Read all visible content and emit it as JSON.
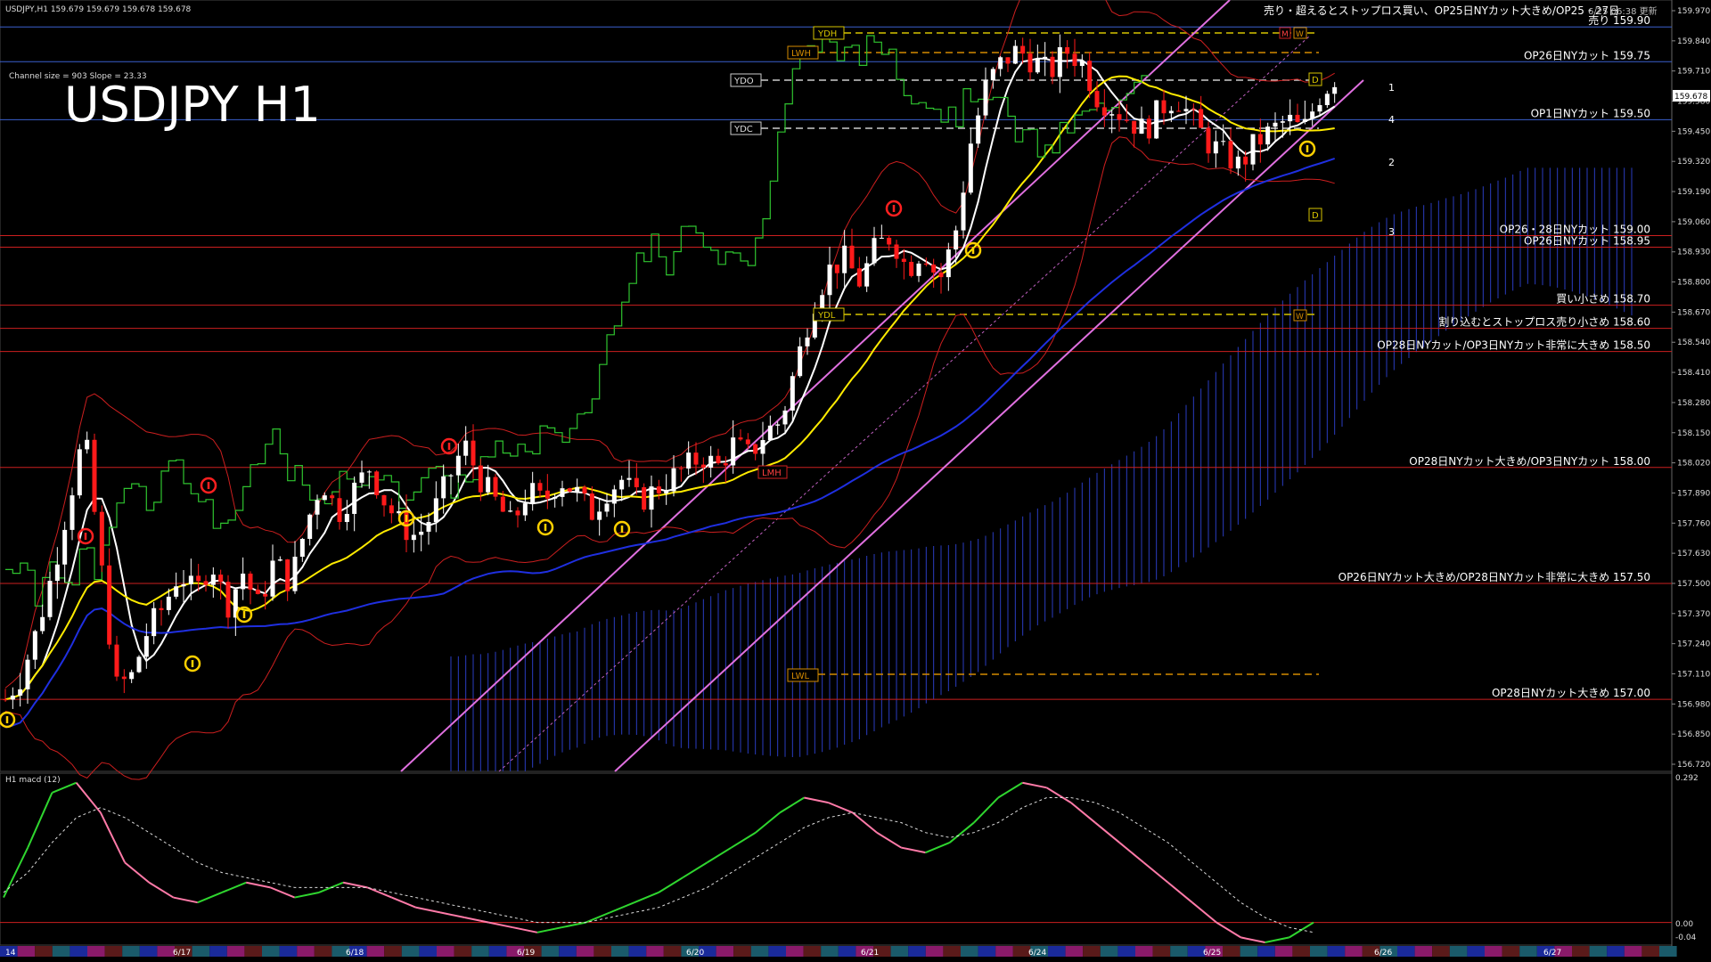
{
  "header": {
    "symbol_info": "USDJPY,H1  159.679 159.679 159.678 159.678",
    "big_title": "USDJPY H1",
    "channel_info": "Channel size = 903 Slope = 23.33",
    "top_right_note": "売り・超えるとストップロス買い、OP25日NYカット大きめ/OP25・27日",
    "update_stamp": "6/25 06:38 更新"
  },
  "price_axis": {
    "ticks": [
      "159.970",
      "159.840",
      "159.710",
      "159.580",
      "159.450",
      "159.320",
      "159.190",
      "159.060",
      "158.930",
      "158.800",
      "158.670",
      "158.540",
      "158.410",
      "158.280",
      "158.150",
      "158.020",
      "157.890",
      "157.760",
      "157.630",
      "157.500",
      "157.370",
      "157.240",
      "157.110",
      "156.980",
      "156.850",
      "156.720"
    ],
    "current_price": "159.678"
  },
  "levels": [
    {
      "label": "売り 159.90",
      "price": 159.9,
      "color": "#3a5fcd"
    },
    {
      "label": "OP26日NYカット 159.75",
      "price": 159.75,
      "color": "#3a5fcd"
    },
    {
      "label": "OP1日NYカット 159.50",
      "price": 159.5,
      "color": "#3a5fcd"
    },
    {
      "label": "OP26・28日NYカット 159.00",
      "price": 159.0,
      "color": "#cc1f1f"
    },
    {
      "label": "OP26日NYカット 158.95",
      "price": 158.95,
      "color": "#cc1f1f"
    },
    {
      "label": "買い小さめ 158.70",
      "price": 158.7,
      "color": "#cc1f1f"
    },
    {
      "label": "割り込むとストップロス売り小さめ 158.60",
      "price": 158.6,
      "color": "#cc1f1f"
    },
    {
      "label": "OP28日NYカット/OP3日NYカット非常に大きめ 158.50",
      "price": 158.5,
      "color": "#cc1f1f"
    },
    {
      "label": "OP28日NYカット大きめ/OP3日NYカット 158.00",
      "price": 158.0,
      "color": "#cc1f1f"
    },
    {
      "label": "OP26日NYカット大きめ/OP28日NYカット非常に大きめ 157.50",
      "price": 157.5,
      "color": "#cc1f1f"
    },
    {
      "label": "OP28日NYカット大きめ 157.00",
      "price": 157.0,
      "color": "#cc1f1f"
    }
  ],
  "markers": {
    "ydh": "YDH",
    "lwh": "LWH",
    "ydo": "YDO",
    "ydc": "YDC",
    "ydl": "YDL",
    "lwl": "LWL",
    "lmh": "LMH",
    "d_top": "D",
    "d_bottom": "D",
    "w_top": "W",
    "m_top": "M",
    "w_bottom": "W",
    "proj_1": "1",
    "proj_2": "2",
    "proj_3": "3",
    "proj_4": "4"
  },
  "macd_panel": {
    "label": "H1  macd (12)",
    "ticks": [
      "0.292",
      "0.00",
      "-0.04"
    ]
  },
  "time_axis": {
    "labels": [
      "14",
      "6/17",
      "6/18",
      "6/19",
      "6/20",
      "6/21",
      "6/24",
      "6/25",
      "6/26",
      "6/27"
    ]
  },
  "chart_data": {
    "type": "candlestick",
    "symbol": "USDJPY",
    "timeframe": "H1",
    "ylim": [
      156.72,
      159.97
    ],
    "close_path": [
      157.0,
      157.1,
      157.3,
      157.55,
      157.85,
      158.15,
      157.6,
      157.05,
      157.1,
      157.3,
      157.4,
      157.55,
      157.45,
      157.6,
      157.4,
      157.55,
      157.4,
      157.6,
      157.5,
      157.75,
      157.95,
      157.8,
      157.9,
      158.0,
      157.85,
      157.75,
      157.7,
      157.8,
      157.95,
      158.1,
      157.95,
      157.85,
      157.75,
      157.9,
      157.85,
      157.95,
      157.9,
      157.8,
      157.9,
      157.95,
      157.85,
      157.9,
      157.95,
      158.0,
      158.05,
      158.0,
      158.1,
      158.05,
      158.15,
      158.2,
      158.45,
      158.7,
      158.85,
      158.9,
      158.8,
      158.95,
      159.0,
      158.85,
      158.95,
      158.8,
      159.0,
      159.4,
      159.65,
      159.75,
      159.8,
      159.75,
      159.7,
      159.8,
      159.75,
      159.6,
      159.55,
      159.5,
      159.45,
      159.55,
      159.6,
      159.5,
      159.4,
      159.35,
      159.3,
      159.4,
      159.45,
      159.5,
      159.45,
      159.6,
      159.68
    ],
    "series": [
      {
        "name": "",
        "color": "#ffffff",
        "kind": "ma-fast"
      },
      {
        "name": "",
        "color": "#ffeb00",
        "kind": "ma-mid"
      },
      {
        "name": "",
        "color": "#1f2fe0",
        "kind": "ma-slow"
      },
      {
        "name": "",
        "color": "#2fc42f",
        "kind": "chikou"
      }
    ],
    "macd": {
      "line": [
        0.05,
        0.15,
        0.26,
        0.28,
        0.22,
        0.12,
        0.08,
        0.05,
        0.04,
        0.06,
        0.08,
        0.07,
        0.05,
        0.06,
        0.08,
        0.07,
        0.05,
        0.03,
        0.02,
        0.01,
        0.0,
        -0.01,
        -0.02,
        -0.01,
        0.0,
        0.02,
        0.04,
        0.06,
        0.09,
        0.12,
        0.15,
        0.18,
        0.22,
        0.25,
        0.24,
        0.22,
        0.18,
        0.15,
        0.14,
        0.16,
        0.2,
        0.25,
        0.28,
        0.27,
        0.24,
        0.2,
        0.16,
        0.12,
        0.08,
        0.04,
        0.0,
        -0.03,
        -0.04,
        -0.03,
        0.0
      ],
      "signal": [
        0.06,
        0.1,
        0.16,
        0.21,
        0.23,
        0.21,
        0.18,
        0.15,
        0.12,
        0.1,
        0.09,
        0.08,
        0.07,
        0.07,
        0.07,
        0.07,
        0.06,
        0.05,
        0.04,
        0.03,
        0.02,
        0.01,
        0.0,
        0.0,
        0.0,
        0.01,
        0.02,
        0.03,
        0.05,
        0.07,
        0.1,
        0.13,
        0.16,
        0.19,
        0.21,
        0.22,
        0.21,
        0.2,
        0.18,
        0.17,
        0.18,
        0.2,
        0.23,
        0.25,
        0.25,
        0.24,
        0.22,
        0.19,
        0.16,
        0.12,
        0.08,
        0.04,
        0.01,
        -0.01,
        -0.02
      ]
    }
  }
}
